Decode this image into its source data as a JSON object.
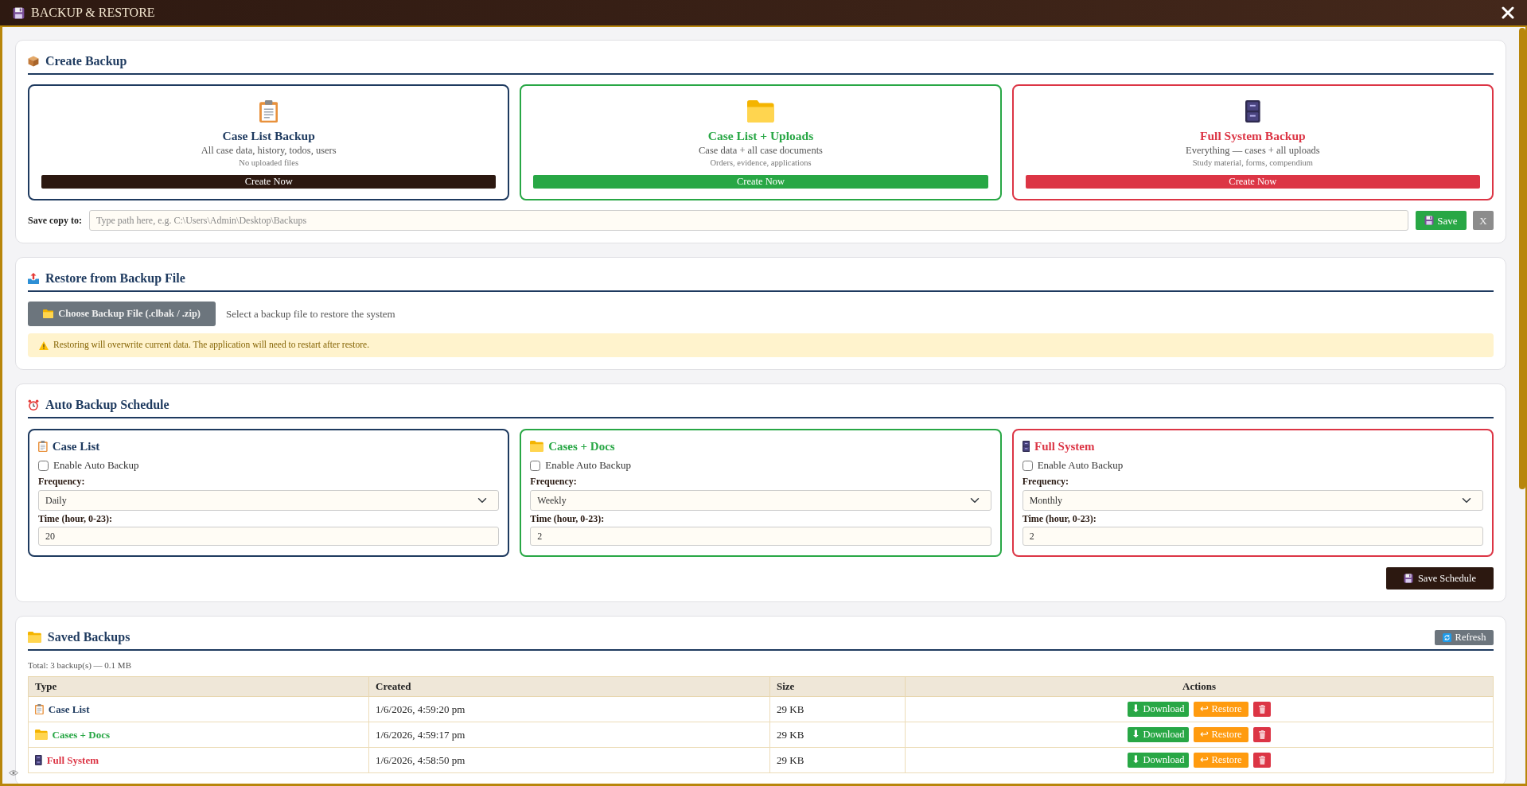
{
  "window": {
    "title": "BACKUP & RESTORE"
  },
  "create_backup": {
    "title": "Create Backup",
    "options": [
      {
        "kind": "case_list",
        "title": "Case List Backup",
        "color": "#1e3a5f",
        "description": "All case data, history, todos, users",
        "note": "No uploaded files",
        "button": "Create Now"
      },
      {
        "kind": "cases_docs",
        "title": "Case List + Uploads",
        "color": "#28a745",
        "description": "Case data + all case documents",
        "note": "Orders, evidence, applications",
        "button": "Create Now"
      },
      {
        "kind": "full_system",
        "title": "Full System Backup",
        "color": "#dc3545",
        "description": "Everything — cases + all uploads",
        "note": "Study material, forms, compendium",
        "button": "Create Now"
      }
    ],
    "save_copy": {
      "label": "Save copy to:",
      "placeholder": "Type path here, e.g. C:\\Users\\Admin\\Desktop\\Backups",
      "save_button": "Save",
      "clear_button": "X"
    }
  },
  "restore": {
    "title": "Restore from Backup File",
    "choose_button": "Choose Backup File (.clbak / .zip)",
    "hint": "Select a backup file to restore the system",
    "warning": "Restoring will overwrite current data. The application will need to restart after restore."
  },
  "auto_backup": {
    "title": "Auto Backup Schedule",
    "schedules": [
      {
        "kind": "case_list",
        "title": "Case List",
        "color": "#1e3a5f",
        "enable_label": "Enable Auto Backup",
        "checked": false,
        "frequency_label": "Frequency:",
        "frequency": "Daily",
        "time_label": "Time (hour, 0-23):",
        "time": "20"
      },
      {
        "kind": "cases_docs",
        "title": "Cases + Docs",
        "color": "#28a745",
        "enable_label": "Enable Auto Backup",
        "checked": false,
        "frequency_label": "Frequency:",
        "frequency": "Weekly",
        "time_label": "Time (hour, 0-23):",
        "time": "2"
      },
      {
        "kind": "full_system",
        "title": "Full System",
        "color": "#dc3545",
        "enable_label": "Enable Auto Backup",
        "checked": false,
        "frequency_label": "Frequency:",
        "frequency": "Monthly",
        "time_label": "Time (hour, 0-23):",
        "time": "2"
      }
    ],
    "save_button": "Save Schedule"
  },
  "saved_backups": {
    "title": "Saved Backups",
    "refresh_button": "Refresh",
    "total": "Total: 3 backup(s) — 0.1 MB",
    "table": {
      "columns": [
        "Type",
        "Created",
        "Size",
        "Actions"
      ],
      "rows": [
        {
          "kind": "case_list",
          "type": "Case List",
          "color": "#1e3a5f",
          "created": "1/6/2026, 4:59:20 pm",
          "size": "29 KB",
          "download_button": "⬇ Download",
          "restore_button": "↩ Restore"
        },
        {
          "kind": "cases_docs",
          "type": "Cases + Docs",
          "color": "#28a745",
          "created": "1/6/2026, 4:59:17 pm",
          "size": "29 KB",
          "download_button": "⬇ Download",
          "restore_button": "↩ Restore"
        },
        {
          "kind": "full_system",
          "type": "Full System",
          "color": "#dc3545",
          "created": "1/6/2026, 4:58:50 pm",
          "size": "29 KB",
          "download_button": "⬇ Download",
          "restore_button": "↩ Restore"
        }
      ]
    }
  }
}
